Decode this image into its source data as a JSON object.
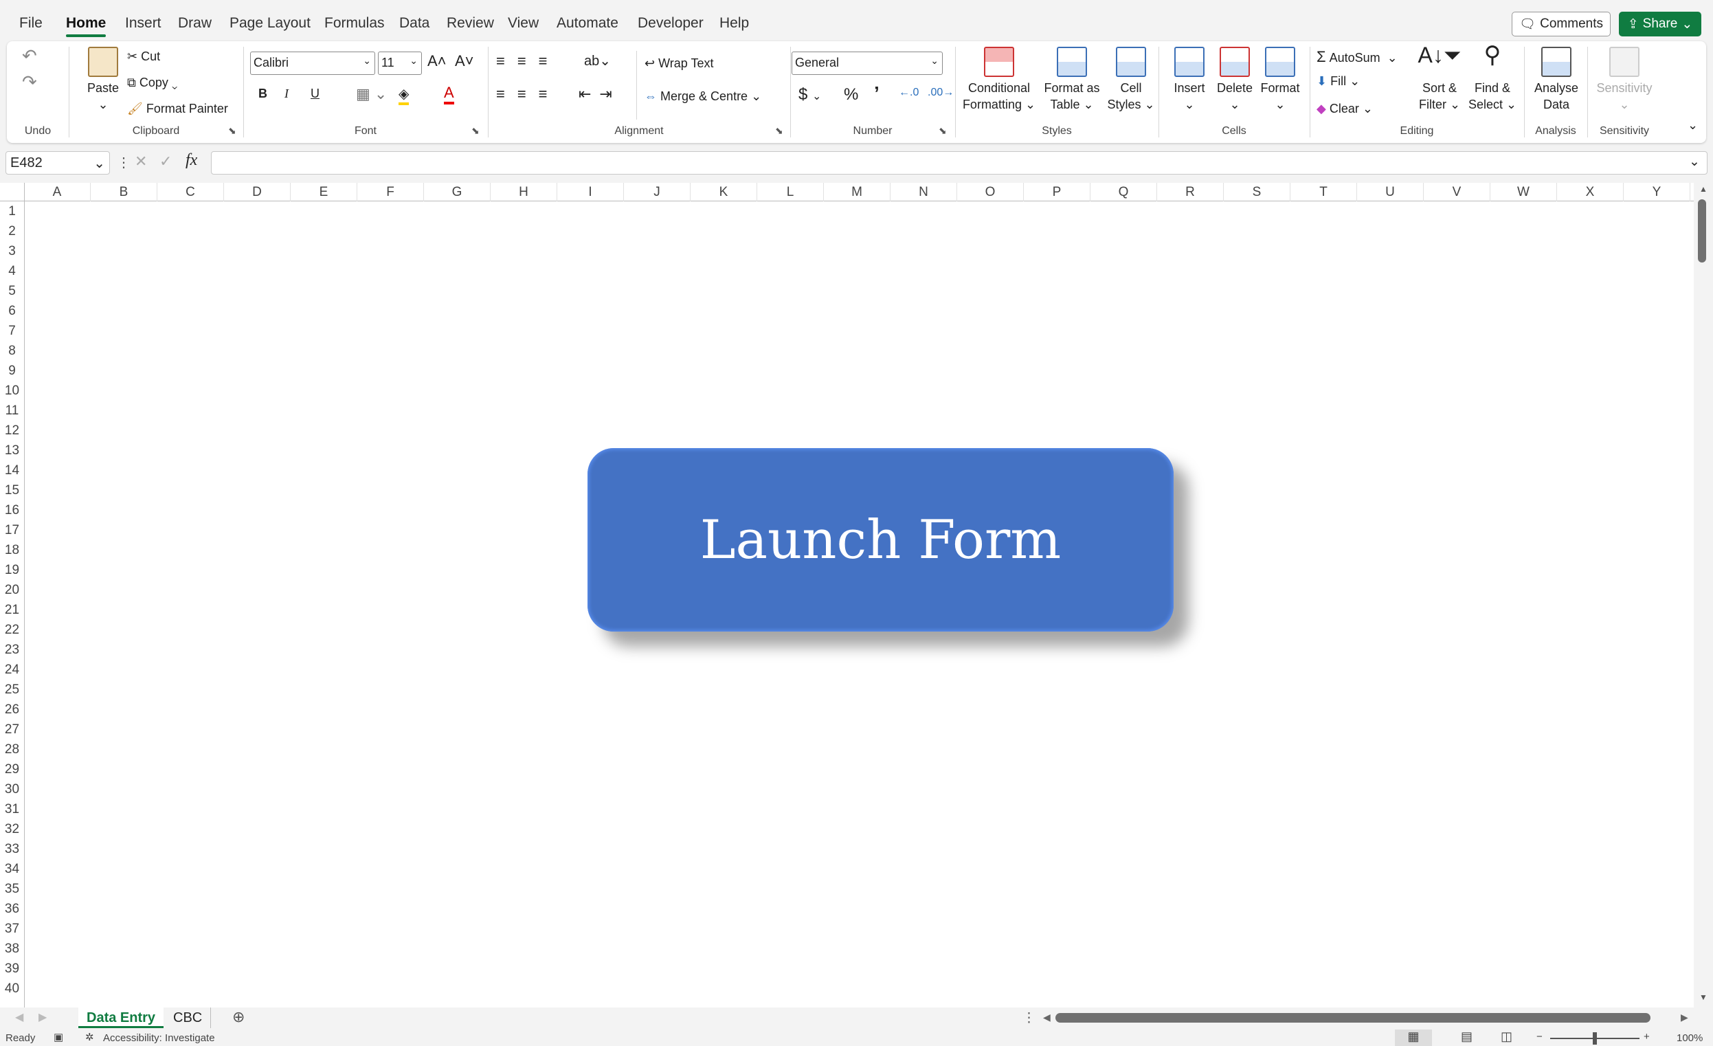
{
  "menu": {
    "tabs": [
      "File",
      "Home",
      "Insert",
      "Draw",
      "Page Layout",
      "Formulas",
      "Data",
      "Review",
      "View",
      "Automate",
      "Developer",
      "Help"
    ],
    "active": "Home",
    "comments": "Comments",
    "share": "Share"
  },
  "ribbon": {
    "groups": {
      "undo": "Undo",
      "clipboard": "Clipboard",
      "font": "Font",
      "alignment": "Alignment",
      "number": "Number",
      "styles": "Styles",
      "cells": "Cells",
      "editing": "Editing",
      "analysis": "Analysis",
      "sensitivity": "Sensitivity"
    },
    "paste": "Paste",
    "cut": "Cut",
    "copy": "Copy",
    "format_painter": "Format Painter",
    "font_name": "Calibri",
    "font_size": "11",
    "bold": "B",
    "italic": "I",
    "underline": "U",
    "wrap_text": "Wrap Text",
    "merge": "Merge & Centre",
    "number_format": "General",
    "currency": "$",
    "percent": "%",
    "comma": "’",
    "conditional_formatting": [
      "Conditional",
      "Formatting"
    ],
    "format_as_table": [
      "Format as",
      "Table"
    ],
    "cell_styles": [
      "Cell",
      "Styles"
    ],
    "insert": "Insert",
    "delete": "Delete",
    "format": "Format",
    "autosum": "AutoSum",
    "fill": "Fill",
    "clear": "Clear",
    "sort_filter": [
      "Sort &",
      "Filter"
    ],
    "find_select": [
      "Find &",
      "Select"
    ],
    "analyse_data": [
      "Analyse",
      "Data"
    ],
    "sensitivity": "Sensitivity"
  },
  "formula_bar": {
    "name_box": "E482",
    "formula": "",
    "fx": "fx"
  },
  "sheet": {
    "columns": [
      "A",
      "B",
      "C",
      "D",
      "E",
      "F",
      "G",
      "H",
      "I",
      "J",
      "K",
      "L",
      "M",
      "N",
      "O",
      "P",
      "Q",
      "R",
      "S",
      "T",
      "U",
      "V",
      "W",
      "X",
      "Y"
    ],
    "row_count": 40,
    "button_label": "Launch Form",
    "button_color": "#4472c4"
  },
  "sheet_tabs": {
    "tabs": [
      "Data Entry",
      "CBC"
    ],
    "active": "Data Entry"
  },
  "status": {
    "ready": "Ready",
    "accessibility": "Accessibility: Investigate",
    "zoom": "100%",
    "zoom_level": 100
  }
}
